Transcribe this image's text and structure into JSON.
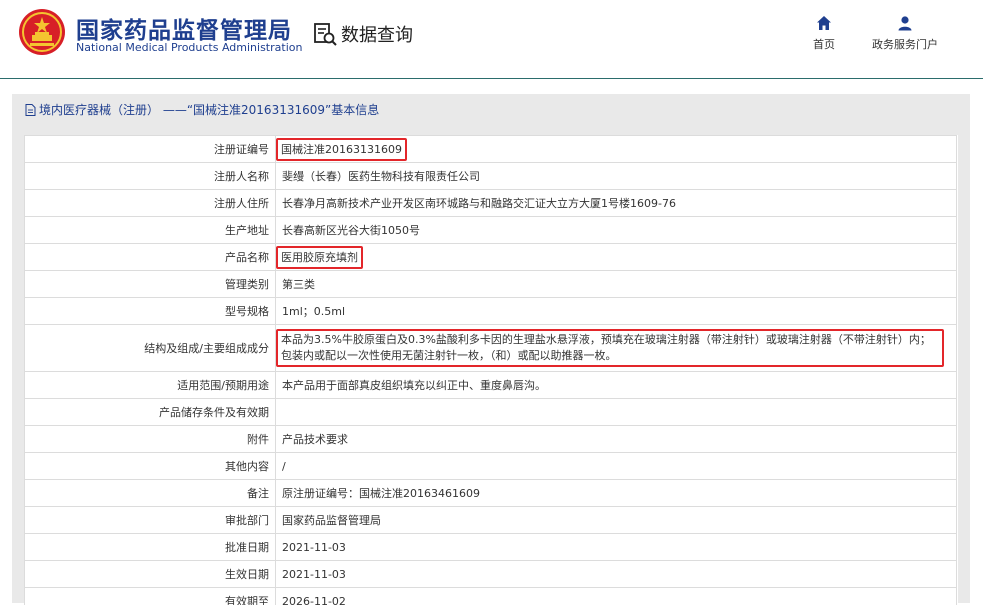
{
  "header": {
    "org_name_cn": "国家药品监督管理局",
    "org_name_en": "National Medical Products Administration",
    "data_query_label": "数据查询",
    "data_query_icon": "document-search-icon",
    "nav": {
      "home_label": "首页",
      "home_icon": "home-icon",
      "portal_label": "政务服务门户",
      "portal_icon": "user-icon"
    }
  },
  "panel": {
    "title": "境内医疗器械（注册） ——“国械注准20163131609”基本信息",
    "title_icon": "document-icon"
  },
  "rows": [
    {
      "label": "注册证编号",
      "value": "国械注准20163131609"
    },
    {
      "label": "注册人名称",
      "value": "斐缦（长春）医药生物科技有限责任公司"
    },
    {
      "label": "注册人住所",
      "value": "长春净月高新技术产业开发区南环城路与和融路交汇证大立方大厦1号楼1609-76"
    },
    {
      "label": "生产地址",
      "value": "长春高新区光谷大街1050号"
    },
    {
      "label": "产品名称",
      "value": "医用胶原充填剂"
    },
    {
      "label": "管理类别",
      "value": "第三类"
    },
    {
      "label": "型号规格",
      "value": "1ml；0.5ml"
    },
    {
      "label": "结构及组成/主要组成成分",
      "value": "本品为3.5%牛胶原蛋白及0.3%盐酸利多卡因的生理盐水悬浮液，预填充在玻璃注射器（带注射针）或玻璃注射器（不带注射针）内；包装内或配以一次性使用无菌注射针一枚，（和）或配以助推器一枚。"
    },
    {
      "label": "适用范围/预期用途",
      "value": "本产品用于面部真皮组织填充以纠正中、重度鼻唇沟。"
    },
    {
      "label": "产品储存条件及有效期",
      "value": ""
    },
    {
      "label": "附件",
      "value": "产品技术要求"
    },
    {
      "label": "其他内容",
      "value": "/"
    },
    {
      "label": "备注",
      "value": "原注册证编号：国械注准20163461609"
    },
    {
      "label": "审批部门",
      "value": "国家药品监督管理局"
    },
    {
      "label": "批准日期",
      "value": "2021-11-03"
    },
    {
      "label": "生效日期",
      "value": "2021-11-03"
    },
    {
      "label": "有效期至",
      "value": "2026-11-02"
    }
  ],
  "colors": {
    "brand_blue": "#1f3f8f",
    "highlight_red": "#e3262a",
    "header_rule": "#2b6d6c",
    "panel_bg": "#e9e9e9"
  }
}
